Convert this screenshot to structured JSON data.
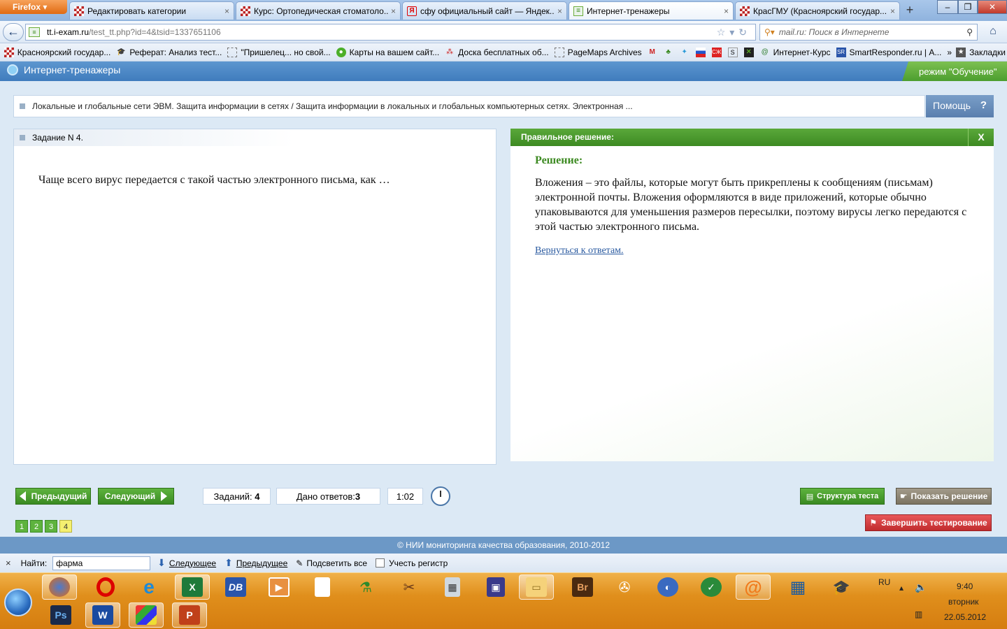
{
  "browser": {
    "menu_button": "Firefox",
    "tabs": [
      {
        "title": "Редактировать категории",
        "icon": "checkered-icon"
      },
      {
        "title": "Курс: Ортопедическая стоматоло...",
        "icon": "checkered-icon"
      },
      {
        "title": "сфу официальный сайт — Яндек...",
        "icon": "yandex-icon"
      },
      {
        "title": "Интернет-тренажеры",
        "icon": "i-exam-icon",
        "active": true
      },
      {
        "title": "КрасГМУ (Красноярский государ...",
        "icon": "checkered-icon"
      }
    ],
    "new_tab": "+",
    "url_host": "tt.i-exam.ru",
    "url_path": "/test_tt.php?id=4&tsid=1337651106",
    "search_placeholder": "mail.ru: Поиск в Интернете",
    "bookmarks": [
      {
        "label": "Красноярский государ...",
        "icon": "checkered-icon"
      },
      {
        "label": "Реферат: Анализ тест...",
        "icon": "cap-icon"
      },
      {
        "label": "\"Пришелец... но свой...",
        "icon": "page-icon"
      },
      {
        "label": "Карты на вашем сайт...",
        "icon": "map-icon"
      },
      {
        "label": "Доска бесплатных об...",
        "icon": "dots-icon"
      },
      {
        "label": "PageMaps Archives",
        "icon": "page-icon"
      },
      {
        "label": "",
        "icon": "gmail-icon"
      },
      {
        "label": "",
        "icon": "tree-icon"
      },
      {
        "label": "",
        "icon": "twitter-icon"
      },
      {
        "label": "",
        "icon": "flag-icon"
      },
      {
        "label": "",
        "icon": "sg-icon"
      },
      {
        "label": "",
        "icon": "s-icon"
      },
      {
        "label": "",
        "icon": "x-icon"
      },
      {
        "label": "Интернет-Курс",
        "icon": "at-icon"
      },
      {
        "label": "SmartResponder.ru | А...",
        "icon": "sr-icon"
      }
    ],
    "bookmarks_more": "»",
    "bookmarks_folder": "Закладки"
  },
  "app": {
    "title": "Интернет-тренажеры",
    "mode": "режим \"Обучение\"",
    "breadcrumb": "Локальные и глобальные сети ЭВМ. Защита информации в сетях / Защита информации в локальных и глобальных компьютерных сетях. Электронная ...",
    "help_label": "Помощь",
    "help_icon": "?",
    "task_header": "Задание N 4.",
    "question": "Чаще всего вирус передается с такой частью электронного письма, как …",
    "solution_header": "Правильное решение:",
    "solution_close": "X",
    "solution_title": "Решение:",
    "solution_text": "Вложения – это файлы, которые могут быть прикреплены к сообщениям (письмам) электронной почты. Вложения оформляются в виде приложений, которые обычно упаковываются для уменьшения размеров пересылки, поэтому вирусы легко передаются с этой частью электронного письма.",
    "back_link": "Вернуться к ответам.",
    "prev_label": "Предыдущий",
    "next_label": "Следующий",
    "tasks_label": "Заданий:",
    "tasks_value": "4",
    "answers_label": "Дано ответов:",
    "answers_value": "3",
    "timer": "1:02",
    "structure_label": "Структура теста",
    "show_solution_label": "Показать решение",
    "finish_label": "Завершить тестирование",
    "task_numbers": [
      "1",
      "2",
      "3",
      "4"
    ],
    "current_task": "4",
    "footer": "© НИИ мониторинга качества образования, 2010-2012"
  },
  "findbar": {
    "close": "×",
    "label": "Найти:",
    "value": "фарма",
    "next": "Следующее",
    "prev": "Предыдущее",
    "highlight": "Подсветить все",
    "match_case": "Учесть регистр"
  },
  "taskbar": {
    "language": "RU",
    "time": "9:40",
    "day": "вторник",
    "date": "22.05.2012"
  },
  "colors": {
    "accent_green": "#4c9e2f",
    "header_blue": "#3f7cbd",
    "finish_red": "#c12c2e",
    "taskbar_orange": "#e08f1c"
  }
}
